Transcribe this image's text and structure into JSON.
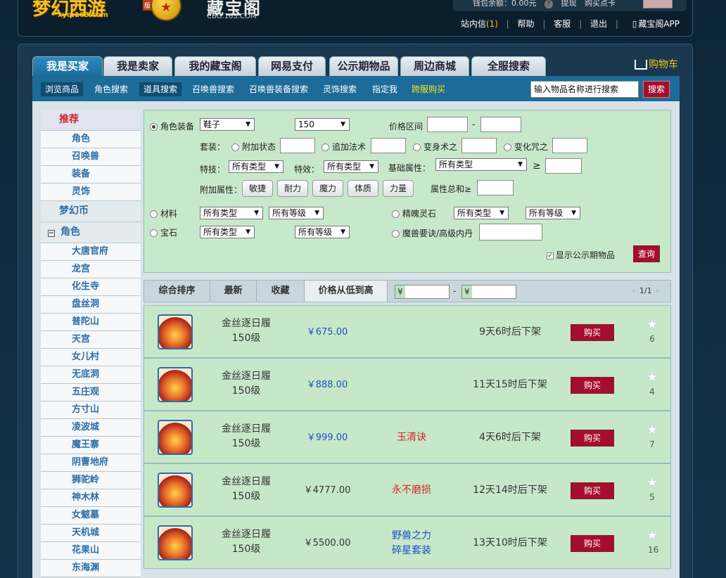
{
  "header": {
    "logo_main": "梦幻西游",
    "logo_sub": "xyq.163.com",
    "logo_badge": "版",
    "brand_cn": "藏宝阁",
    "brand_url": "CBG.163.COM",
    "wallet_text": "钱包余额：0.00元",
    "wallet_withdraw": "提现",
    "wallet_card": "购买点卡",
    "nav": {
      "messages": "站内信",
      "messages_count": "(1)",
      "help": "帮助",
      "service": "客服",
      "logout": "退出",
      "app": "藏宝阁APP"
    }
  },
  "tabs": [
    "我是买家",
    "我是卖家",
    "我的藏宝阁",
    "网易支付",
    "公示期物品",
    "周边商城",
    "全服搜索"
  ],
  "cart_label": "购物车",
  "subnav": [
    "浏览商品",
    "角色搜索",
    "道具搜索",
    "召唤兽搜索",
    "召唤兽装备搜索",
    "灵饰搜索",
    "指定我",
    "跨服购买"
  ],
  "search": {
    "placeholder": "输入物品名称进行搜索",
    "button": "搜索"
  },
  "sidebar": {
    "recommend": "推荐",
    "recommend_items": [
      "角色",
      "召唤兽",
      "装备",
      "灵饰"
    ],
    "currency": "梦幻币",
    "role_group": "角色",
    "role_toggle": "−",
    "schools": [
      "大唐官府",
      "龙宫",
      "化生寺",
      "盘丝洞",
      "普陀山",
      "天宫",
      "女儿村",
      "无底洞",
      "五庄观",
      "方寸山",
      "凌波城",
      "魔王寨",
      "阴曹地府",
      "狮驼岭",
      "神木林",
      "女魃墓",
      "天机城",
      "花果山",
      "东海渊"
    ]
  },
  "filter": {
    "equip_label": "角色装备",
    "equip_type": "鞋子",
    "level": "150",
    "price_range": "价格区间",
    "dash": "-",
    "suit_label": "套装：",
    "suit_opts": [
      "附加状态",
      "追加法术",
      "变身术之",
      "变化咒之"
    ],
    "skill_label": "特技：",
    "skill_val": "所有类型",
    "effect_label": "特效：",
    "effect_val": "所有类型",
    "base_label": "基础属性：",
    "base_val": "所有类型",
    "ge": "≥",
    "add_label": "附加属性：",
    "add_btns": [
      "敏捷",
      "耐力",
      "魔力",
      "体质",
      "力量"
    ],
    "attr_sum": "属性总和≥",
    "material": "材料",
    "material_type": "所有类型",
    "material_level": "所有等级",
    "jinghun": "精魄灵石",
    "jinghun_type": "所有类型",
    "jinghun_level": "所有等级",
    "gem": "宝石",
    "gem_type": "所有类型",
    "gem_level": "所有等级",
    "beast_book": "魔兽要诀/高级内丹",
    "show_public": "显示公示期物品",
    "query": "查询"
  },
  "sortbar": {
    "items": [
      "综合排序",
      "最新",
      "收藏",
      "价格从低到高"
    ],
    "yen": "¥",
    "dash": "-",
    "page": "1/1",
    "prev": "‹",
    "next": "›"
  },
  "items": [
    {
      "name": "金丝逐日履",
      "level": "150级",
      "price": "￥675.00",
      "price_color": "blue",
      "tag": "",
      "time": "9天6时后下架",
      "buy": "购买",
      "fav": "6"
    },
    {
      "name": "金丝逐日履",
      "level": "150级",
      "price": "￥888.00",
      "price_color": "blue",
      "tag": "",
      "time": "11天15时后下架",
      "buy": "购买",
      "fav": "4"
    },
    {
      "name": "金丝逐日履",
      "level": "150级",
      "price": "￥999.00",
      "price_color": "blue",
      "tag": "玉清诀",
      "time": "4天6时后下架",
      "buy": "购买",
      "fav": "7"
    },
    {
      "name": "金丝逐日履",
      "level": "150级",
      "price": "￥4777.00",
      "price_color": "black",
      "tag": "永不磨损",
      "time": "12天14时后下架",
      "buy": "购买",
      "fav": "5"
    },
    {
      "name": "金丝逐日履",
      "level": "150级",
      "price": "￥5500.00",
      "price_color": "black",
      "tag": "野兽之力\n碎星套装",
      "time": "13天10时后下架",
      "buy": "购买",
      "fav": "16"
    }
  ]
}
